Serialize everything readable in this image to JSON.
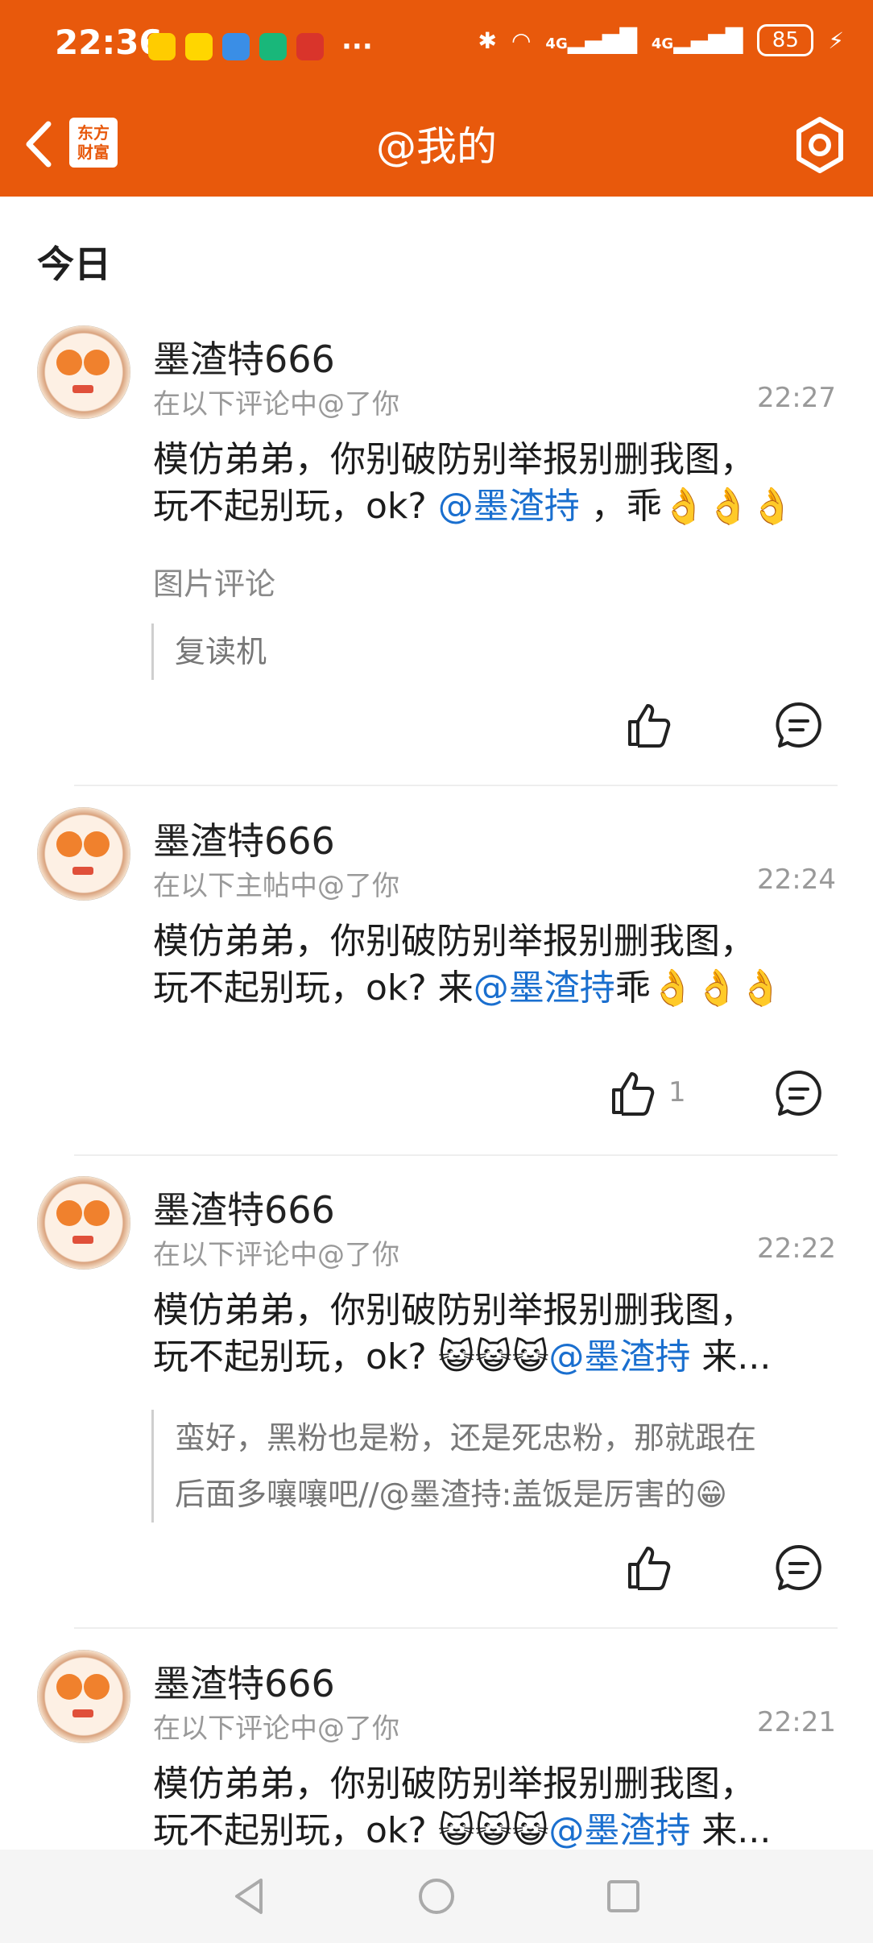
{
  "status_bar": {
    "time": "22:36",
    "battery": "85",
    "network": "4G"
  },
  "header": {
    "title": "@我的",
    "logo_line1": "东方",
    "logo_line2": "财富"
  },
  "section": {
    "title": "今日"
  },
  "items": [
    {
      "username": "墨渣特666",
      "context": "在以下评论中@了你",
      "time": "22:27",
      "line1": "模仿弟弟，你别破防别举报别删我图，",
      "line2_pre": "玩不起别玩，ok? ",
      "mention": "@墨渣持",
      "line2_post": " ，乖👌👌👌",
      "sub_label": "图片评论",
      "quote": "复读机"
    },
    {
      "username": "墨渣特666",
      "context": "在以下主帖中@了你",
      "time": "22:24",
      "line1": "模仿弟弟，你别破防别举报别删我图，",
      "line2_pre": "玩不起别玩，ok? 来",
      "mention": "@墨渣持",
      "line2_post": "乖👌👌👌",
      "like_count": "1"
    },
    {
      "username": "墨渣特666",
      "context": "在以下评论中@了你",
      "time": "22:22",
      "line1": "模仿弟弟，你别破防别举报别删我图，",
      "line2_pre": "玩不起别玩，ok? 😺😺😺",
      "mention": "@墨渣持",
      "line2_post": " 来...",
      "quote_line1": "蛮好，黑粉也是粉，还是死忠粉，那就跟在",
      "quote_line2": "后面多嚷嚷吧//@墨渣持:盖饭是厉害的😁"
    },
    {
      "username": "墨渣特666",
      "context": "在以下评论中@了你",
      "time": "22:21",
      "line1": "模仿弟弟，你别破防别举报别删我图，",
      "line2_pre": "玩不起别玩，ok? 😺😺😺",
      "mention": "@墨渣持",
      "line2_post": " 来..."
    }
  ],
  "colors": {
    "brand": "#e8590c",
    "mention": "#1a6fcf"
  }
}
